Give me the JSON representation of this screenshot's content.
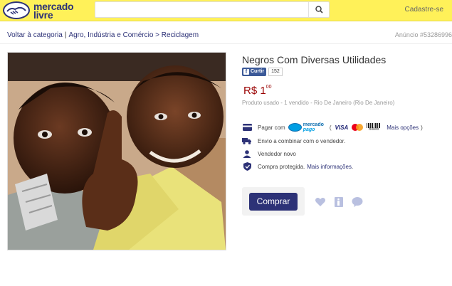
{
  "header": {
    "logo_line1": "mercado",
    "logo_line2": "livre",
    "search_placeholder": "",
    "signup_label": "Cadastre-se"
  },
  "breadcrumb": {
    "back_label": "Voltar à categoria",
    "path": [
      "Agro, Indústria e Comércio",
      "Reciclagem"
    ],
    "separator": ">"
  },
  "listing_id_label": "Anúncio #53286996",
  "product": {
    "title": "Negros Com Diversas Utilidades",
    "facebook_like_label": "Curtir",
    "facebook_count": "152",
    "price_main": "R$ 1",
    "price_cents": "00",
    "meta": "Produto usado  -  1 vendido  -  Rio De Janeiro (Rio De Janeiro)"
  },
  "payment": {
    "label": "Pagar com",
    "mp_line1": "mercado",
    "mp_line2": "pago",
    "paren_open": "(",
    "visa": "VISA",
    "boleto": "Boleto",
    "more_options": "Mais opções",
    "paren_close": ")"
  },
  "shipping_label": "Envio a combinar com o vendedor.",
  "seller_label": "Vendedor novo",
  "protection": {
    "label": "Compra protegida.",
    "link": "Mais informações",
    "end": "."
  },
  "buy_button_label": "Comprar",
  "colors": {
    "header_bg": "#fff159",
    "brand_blue": "#2d3277",
    "price_red": "#990000",
    "icon_light": "#b9c0e0"
  },
  "icons": [
    "handshake-logo-icon",
    "search-icon",
    "mercadopago-icon",
    "truck-icon",
    "user-icon",
    "shield-icon",
    "heart-icon",
    "print-icon",
    "question-icon"
  ]
}
